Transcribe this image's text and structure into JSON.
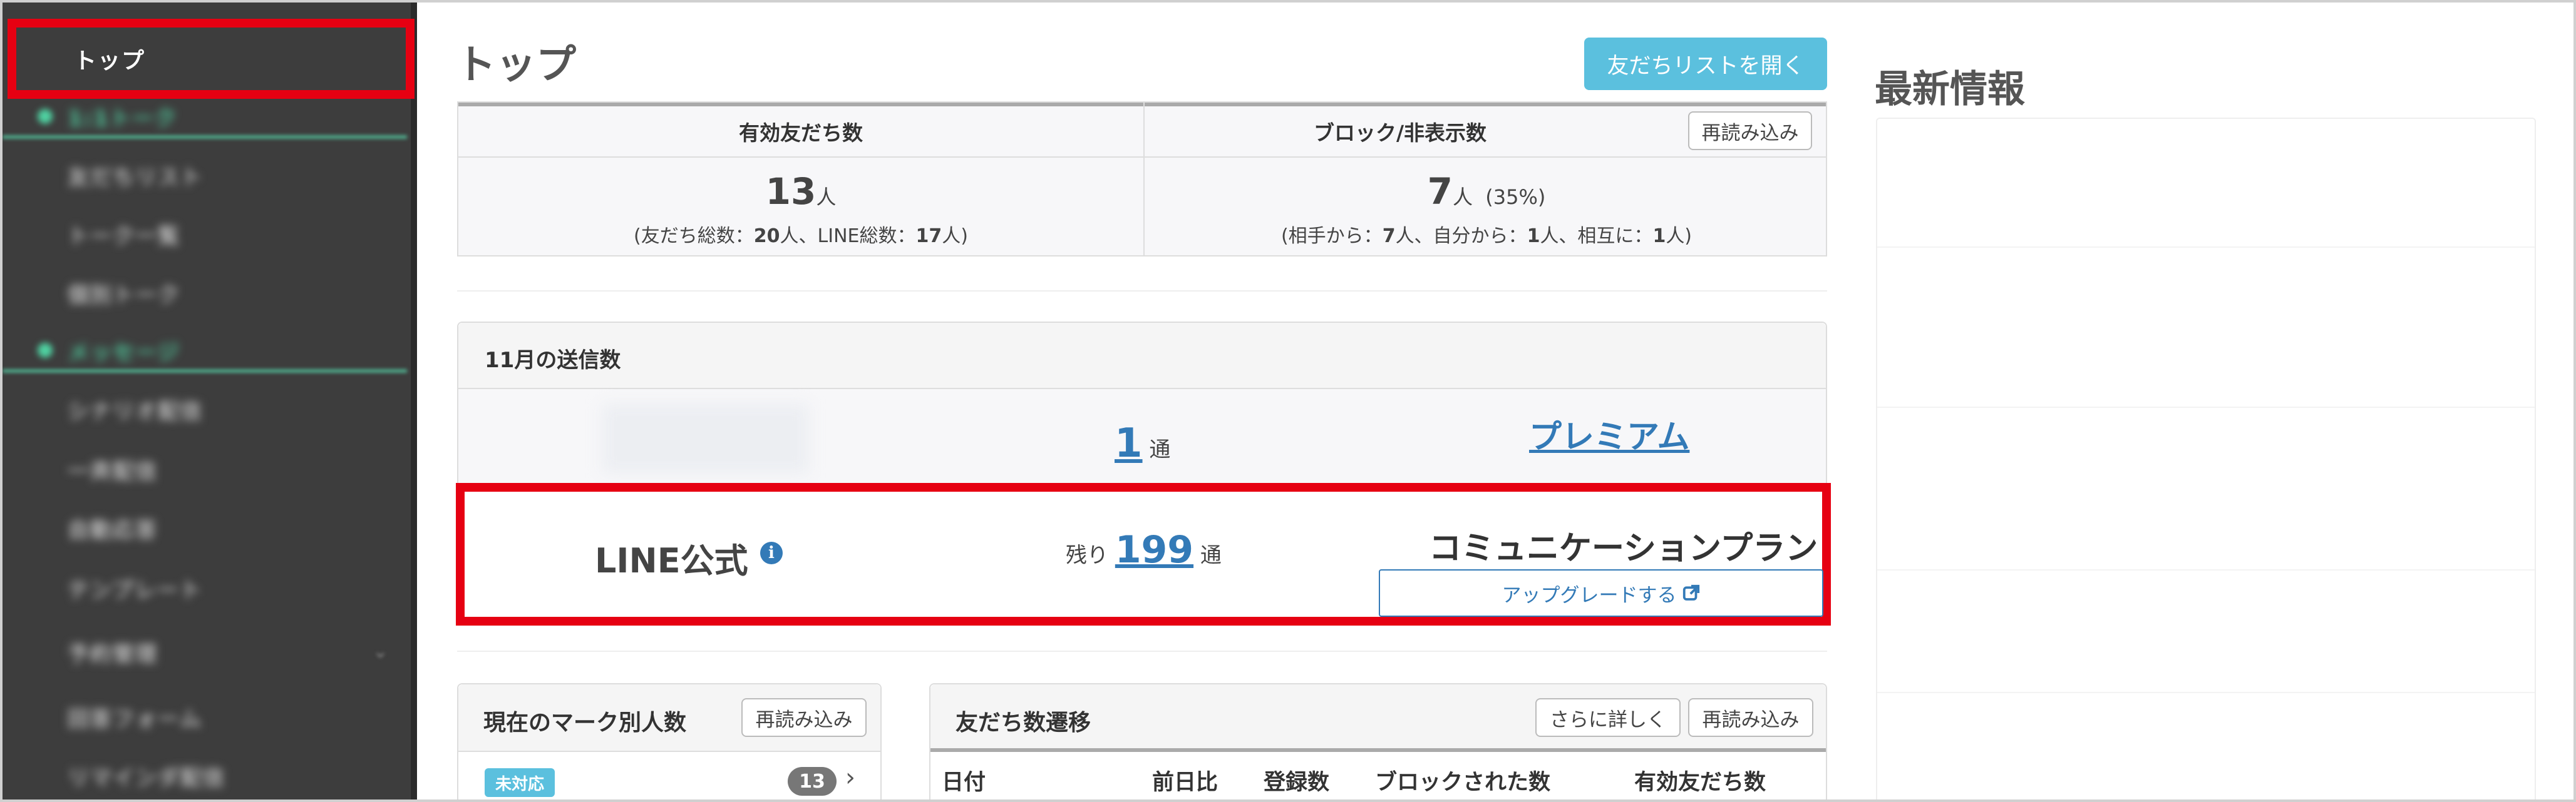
{
  "sidebar": {
    "top_label": "トップ",
    "items": [
      {
        "label": "1:1トーク",
        "category": true
      },
      {
        "label": "友だちリスト"
      },
      {
        "label": "トーク一覧"
      },
      {
        "label": "個別トーク"
      },
      {
        "label": "メッセージ",
        "category": true
      },
      {
        "label": "シナリオ配信"
      },
      {
        "label": "一斉配信"
      },
      {
        "label": "自動応答"
      },
      {
        "label": "テンプレート"
      },
      {
        "label": "予約管理"
      },
      {
        "label": "回答フォーム"
      },
      {
        "label": "リマインダ配信"
      }
    ]
  },
  "header": {
    "title": "トップ",
    "open_friend_list": "友だちリストを開く"
  },
  "friend_stats": {
    "valid_label": "有効友だち数",
    "valid_count": "13",
    "valid_unit": "人",
    "valid_sub_pre": "(友だち総数：",
    "valid_sub_total": "20",
    "valid_sub_mid": "人、LINE総数：",
    "valid_sub_line": "17",
    "valid_sub_post": "人)",
    "blocked_label": "ブロック/非表示数",
    "reload": "再読み込み",
    "blocked_count": "7",
    "blocked_unit": "人",
    "blocked_pct": "(35%)",
    "blocked_sub_pre": "(相手から：",
    "blocked_sub_them": "7",
    "blocked_sub_mid1": "人、自分から：",
    "blocked_sub_self": "1",
    "blocked_sub_mid2": "人、相互に：",
    "blocked_sub_mutual": "1",
    "blocked_sub_post": "人)"
  },
  "send_panel": {
    "title": "11月の送信数",
    "used_count": "1",
    "used_unit": "通",
    "plan_name": "プレミアム",
    "line_official": "LINE公式",
    "remain_label": "残り",
    "remain_count": "199",
    "remain_unit": "通",
    "plan_type": "コミュニケーションプラン",
    "upgrade": "アップグレードする"
  },
  "marks_panel": {
    "title": "現在のマーク別人数",
    "reload": "再読み込み",
    "tag": "未対応",
    "count": "13"
  },
  "transition_panel": {
    "title": "友だち数遷移",
    "more": "さらに詳しく",
    "reload": "再読み込み",
    "columns": [
      "日付",
      "前日比",
      "登録数",
      "ブロックされた数",
      "有効友だち数"
    ]
  },
  "news": {
    "title": "最新情報"
  },
  "colors": {
    "highlight": "#e60012",
    "link": "#337ab7",
    "info_button": "#5bc0de",
    "sidebar_bg": "#3d3d3d",
    "sidebar_accent": "#4fd1a1"
  },
  "icons": {
    "info": "info-circle-icon",
    "external": "external-link-icon",
    "chevron": "chevron-right-icon"
  }
}
